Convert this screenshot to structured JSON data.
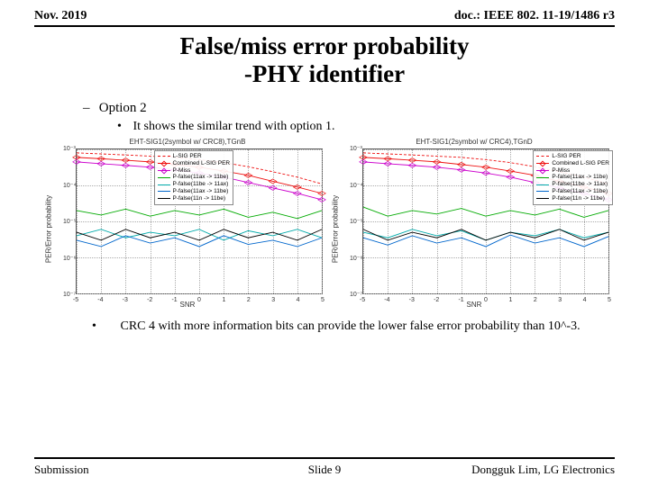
{
  "header": {
    "date": "Nov. 2019",
    "doc": "doc.: IEEE 802. 11-19/1486 r3"
  },
  "title": {
    "l1": "False/miss error probability",
    "l2": "-PHY identifier"
  },
  "body": {
    "option_label": "Option 2",
    "sub1": "It shows the similar trend with option 1.",
    "sub2": "CRC 4 with more information bits can provide the lower false error probability than 10^-3."
  },
  "footer": {
    "left": "Submission",
    "center": "Slide 9",
    "right": "Dongguk Lim, LG Electronics"
  },
  "chart_colors": {
    "lsig": "#e11",
    "combined": "#e11",
    "pmiss": "#c0c",
    "pfalse_ax_be": "#0a0",
    "pfalse_be_ax": "#0aa",
    "pfalse_ax_be2": "#06c",
    "pfalse_n_be": "#000"
  },
  "chart_data": [
    {
      "type": "line",
      "title": "EHT-SIG1(2symbol w/ CRC8),TGnB",
      "xlabel": "SNR",
      "ylabel": "PER/Error probability",
      "xlim": [
        -5,
        5
      ],
      "ylog": true,
      "ylim": [
        1e-07,
        0.001
      ],
      "yticks": [
        0.001,
        0.0001,
        1e-05,
        1e-06,
        1e-07
      ],
      "ytick_labels": [
        "10⁻³",
        "10⁻⁴",
        "10⁻⁵",
        "10⁻⁶",
        "10⁻⁷"
      ],
      "xticks": [
        -5,
        -4,
        -3,
        -2,
        -1,
        0,
        1,
        2,
        3,
        4,
        5
      ],
      "legend": [
        "L-SIG PER",
        "Combined L-SIG PER",
        "P-Miss",
        "P-false(11ax -> 11be)",
        "P-false(11be -> 11ax)",
        "P-false(11ax -> 11be)",
        "P-false(11n -> 11be)"
      ],
      "series": [
        {
          "name": "L-SIG PER",
          "color": "lsig",
          "style": "dashed",
          "x": [
            -5,
            -4,
            -3,
            -2,
            -1,
            0,
            1,
            2,
            3,
            4,
            5
          ],
          "y": [
            0.0008,
            0.00075,
            0.0007,
            0.00065,
            0.0006,
            0.00052,
            0.00043,
            0.00033,
            0.00024,
            0.00017,
            0.00011
          ]
        },
        {
          "name": "Combined L-SIG PER",
          "color": "combined",
          "style": "solid",
          "marker": "diamond",
          "x": [
            -5,
            -4,
            -3,
            -2,
            -1,
            0,
            1,
            2,
            3,
            4,
            5
          ],
          "y": [
            0.0006,
            0.00055,
            0.0005,
            0.00045,
            0.00038,
            0.00032,
            0.00025,
            0.00019,
            0.00013,
            9e-05,
            6e-05
          ]
        },
        {
          "name": "P-Miss",
          "color": "pmiss",
          "style": "solid",
          "marker": "diamond",
          "x": [
            -5,
            -4,
            -3,
            -2,
            -1,
            0,
            1,
            2,
            3,
            4,
            5
          ],
          "y": [
            0.00045,
            0.0004,
            0.00036,
            0.00032,
            0.00027,
            0.00022,
            0.00017,
            0.00012,
            8.5e-05,
            6e-05,
            4e-05
          ]
        },
        {
          "name": "P-false ax->be",
          "color": "pfalse_ax_be",
          "style": "solid",
          "x": [
            -5,
            -4,
            -3,
            -2,
            -1,
            0,
            1,
            2,
            3,
            4,
            5
          ],
          "y": [
            2e-05,
            1.5e-05,
            2.2e-05,
            1.4e-05,
            2e-05,
            1.5e-05,
            2.2e-05,
            1.3e-05,
            1.8e-05,
            1.2e-05,
            2e-05
          ]
        },
        {
          "name": "P-false be->ax",
          "color": "pfalse_be_ax",
          "style": "solid",
          "x": [
            -5,
            -4,
            -3,
            -2,
            -1,
            0,
            1,
            2,
            3,
            4,
            5
          ],
          "y": [
            4e-06,
            6e-06,
            3.5e-06,
            5e-06,
            4e-06,
            6e-06,
            3e-06,
            5.5e-06,
            4e-06,
            6e-06,
            3.5e-06
          ]
        },
        {
          "name": "P-false ax->be2",
          "color": "pfalse_ax_be2",
          "style": "solid",
          "x": [
            -5,
            -4,
            -3,
            -2,
            -1,
            0,
            1,
            2,
            3,
            4,
            5
          ],
          "y": [
            3e-06,
            2e-06,
            4e-06,
            2.5e-06,
            3.5e-06,
            2e-06,
            4e-06,
            2.3e-06,
            3e-06,
            2e-06,
            3.5e-06
          ]
        },
        {
          "name": "P-false n->be",
          "color": "pfalse_n_be",
          "style": "solid",
          "x": [
            -5,
            -4,
            -3,
            -2,
            -1,
            0,
            1,
            2,
            3,
            4,
            5
          ],
          "y": [
            5e-06,
            3e-06,
            6e-06,
            3.5e-06,
            5e-06,
            3e-06,
            6e-06,
            3.5e-06,
            5e-06,
            3e-06,
            6e-06
          ]
        }
      ]
    },
    {
      "type": "line",
      "title": "EHT-SIG1(2symbol w/ CRC4),TGnD",
      "xlabel": "SNR",
      "ylabel": "PER/Error probability",
      "xlim": [
        -5,
        5
      ],
      "ylog": true,
      "ylim": [
        1e-07,
        0.001
      ],
      "yticks": [
        0.001,
        0.0001,
        1e-05,
        1e-06,
        1e-07
      ],
      "ytick_labels": [
        "10⁻³",
        "10⁻⁴",
        "10⁻⁵",
        "10⁻⁶",
        "10⁻⁷"
      ],
      "xticks": [
        -5,
        -4,
        -3,
        -2,
        -1,
        0,
        1,
        2,
        3,
        4,
        5
      ],
      "legend": [
        "L-SIG PER",
        "Combined L-SIG PER",
        "P-Miss",
        "P-false(11ax -> 11be)",
        "P-false(11be -> 11ax)",
        "P-false(11ax -> 11be)",
        "P-false(11n -> 11be)"
      ],
      "series": [
        {
          "name": "L-SIG PER",
          "color": "lsig",
          "style": "dashed",
          "x": [
            -5,
            -4,
            -3,
            -2,
            -1,
            0,
            1,
            2,
            3,
            4,
            5
          ],
          "y": [
            0.0008,
            0.00075,
            0.0007,
            0.00065,
            0.0006,
            0.00052,
            0.00043,
            0.00033,
            0.00024,
            0.00017,
            0.00011
          ]
        },
        {
          "name": "Combined L-SIG PER",
          "color": "combined",
          "style": "solid",
          "marker": "diamond",
          "x": [
            -5,
            -4,
            -3,
            -2,
            -1,
            0,
            1,
            2,
            3,
            4,
            5
          ],
          "y": [
            0.0006,
            0.00055,
            0.0005,
            0.00045,
            0.00038,
            0.00032,
            0.00025,
            0.00019,
            0.00013,
            9e-05,
            6e-05
          ]
        },
        {
          "name": "P-Miss",
          "color": "pmiss",
          "style": "solid",
          "marker": "diamond",
          "x": [
            -5,
            -4,
            -3,
            -2,
            -1,
            0,
            1,
            2,
            3,
            4,
            5
          ],
          "y": [
            0.00045,
            0.0004,
            0.00036,
            0.00032,
            0.00027,
            0.00022,
            0.00017,
            0.00012,
            8.5e-05,
            6e-05,
            4e-05
          ]
        },
        {
          "name": "P-false ax->be",
          "color": "pfalse_ax_be",
          "style": "solid",
          "x": [
            -5,
            -4,
            -3,
            -2,
            -1,
            0,
            1,
            2,
            3,
            4,
            5
          ],
          "y": [
            2.5e-05,
            1.4e-05,
            2e-05,
            1.6e-05,
            2.3e-05,
            1.4e-05,
            2e-05,
            1.5e-05,
            2.2e-05,
            1.3e-05,
            2e-05
          ]
        },
        {
          "name": "P-false be->ax",
          "color": "pfalse_be_ax",
          "style": "solid",
          "x": [
            -5,
            -4,
            -3,
            -2,
            -1,
            0,
            1,
            2,
            3,
            4,
            5
          ],
          "y": [
            5e-06,
            3.5e-06,
            6e-06,
            4e-06,
            5.5e-06,
            3e-06,
            5e-06,
            4e-06,
            6e-06,
            3.5e-06,
            5e-06
          ]
        },
        {
          "name": "P-false ax->be2",
          "color": "pfalse_ax_be2",
          "style": "solid",
          "x": [
            -5,
            -4,
            -3,
            -2,
            -1,
            0,
            1,
            2,
            3,
            4,
            5
          ],
          "y": [
            3.5e-06,
            2.2e-06,
            4e-06,
            2.5e-06,
            3.5e-06,
            2e-06,
            4.2e-06,
            2.5e-06,
            3.5e-06,
            2e-06,
            3.8e-06
          ]
        },
        {
          "name": "P-false n->be",
          "color": "pfalse_n_be",
          "style": "solid",
          "x": [
            -5,
            -4,
            -3,
            -2,
            -1,
            0,
            1,
            2,
            3,
            4,
            5
          ],
          "y": [
            6e-06,
            3e-06,
            5e-06,
            3.5e-06,
            6e-06,
            3e-06,
            5e-06,
            3.5e-06,
            6e-06,
            3e-06,
            5e-06
          ]
        }
      ]
    }
  ]
}
